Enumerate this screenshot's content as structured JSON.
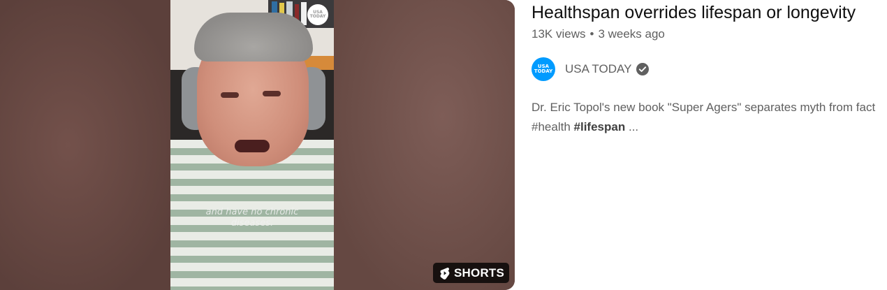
{
  "video": {
    "title": "Healthspan overrides lifespan or longevity",
    "views": "13K views",
    "separator": "•",
    "age": "3 weeks ago",
    "thumbnail": {
      "caption_line1": "and have no chronic",
      "caption_line2": "diseases.",
      "watermark_line1": "USA",
      "watermark_line2": "TODAY",
      "badge_label": "SHORTS"
    },
    "channel": {
      "name": "USA TODAY",
      "avatar_line1": "USA",
      "avatar_line2": "TODAY",
      "verified": true,
      "avatar_color": "#009bff"
    },
    "description": {
      "line1": "Dr. Eric Topol's new book \"Super Agers\" separates myth from fact",
      "tag1": "#health",
      "tag2_prefix": "#",
      "tag2_bold": "lifespan",
      "ellipsis": "..."
    }
  }
}
